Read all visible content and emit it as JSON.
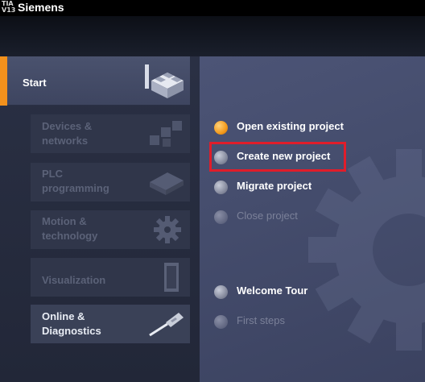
{
  "window": {
    "logo_top": "TIA",
    "logo_bottom": "V13",
    "title": "Siemens"
  },
  "nav": {
    "start_label": "Start",
    "items": [
      {
        "label_line1": "Devices &",
        "label_line2": "networks",
        "enabled": false,
        "icon": "devices-networks-icon"
      },
      {
        "label_line1": "PLC",
        "label_line2": "programming",
        "enabled": false,
        "icon": "plc-programming-icon"
      },
      {
        "label_line1": "Motion &",
        "label_line2": "technology",
        "enabled": false,
        "icon": "motion-gear-icon"
      },
      {
        "label_line1": "Visualization",
        "label_line2": "",
        "enabled": false,
        "icon": "visualization-panel-icon"
      },
      {
        "label_line1": "Online &",
        "label_line2": "Diagnostics",
        "enabled": true,
        "icon": "screwdriver-icon"
      }
    ]
  },
  "actions": [
    {
      "label": "Open existing project",
      "enabled": true,
      "active": true
    },
    {
      "label": "Create new project",
      "enabled": true,
      "highlighted": true
    },
    {
      "label": "Migrate project",
      "enabled": true
    },
    {
      "label": "Close project",
      "enabled": false
    },
    {
      "label": "Welcome Tour",
      "enabled": true
    },
    {
      "label": "First steps",
      "enabled": false
    }
  ],
  "colors": {
    "accent": "#f3911c",
    "highlight": "#e01d2a"
  }
}
